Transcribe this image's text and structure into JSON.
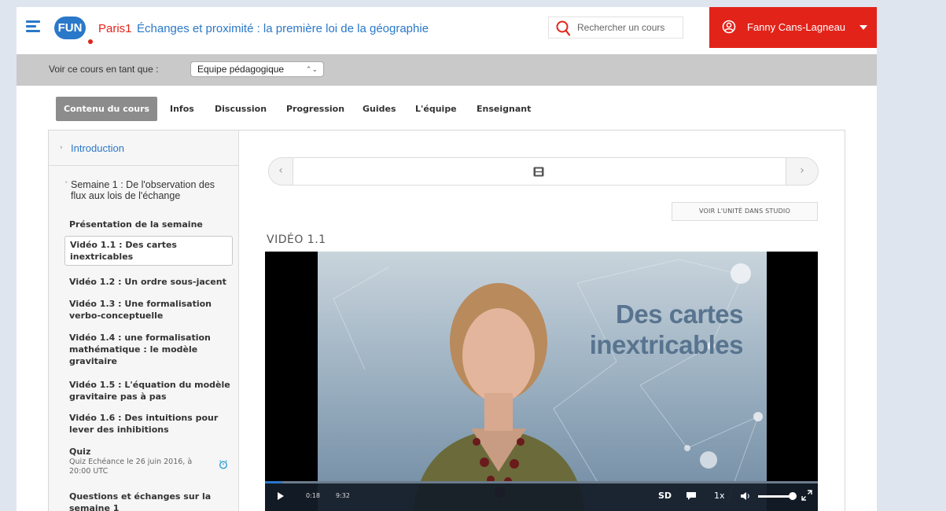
{
  "header": {
    "logo": "FUN",
    "course_org": "Paris1",
    "course_title": "Échanges et proximité : la première loi de la géographie",
    "search_placeholder": "Rechercher un cours",
    "user_name": "Fanny Cans-Lagneau"
  },
  "view_as": {
    "label": "Voir ce cours en tant que :",
    "selected": "Equipe pédagogique",
    "arrows": "⌃⌄"
  },
  "tabs": [
    "Contenu du cours",
    "Infos",
    "Discussion",
    "Progression",
    "Guides",
    "L'équipe",
    "Enseignant"
  ],
  "sidebar": {
    "intro": "Introduction",
    "week": "Semaine 1 : De l'observation des flux aux lois de l'échange",
    "items": [
      "Présentation de la semaine",
      "Vidéo 1.1 : Des cartes inextricables",
      "Vidéo 1.2 : Un ordre sous-jacent",
      "Vidéo 1.3 : Une formalisation verbo-conceptuelle",
      "Vidéo 1.4 : une formalisation mathématique : le modèle gravitaire",
      "Vidéo 1.5 : L'équation du modèle gravitaire pas à pas",
      "Vidéo 1.6 : Des intuitions pour lever des inhibitions",
      "Quiz",
      "Questions et échanges sur la semaine 1"
    ],
    "quiz_due": "Quiz Echéance le 26 juin 2016, à 20:00 UTC"
  },
  "main": {
    "studio_button": "VOIR L'UNITÉ DANS STUDIO",
    "video_heading": "VIDÉO 1.1",
    "video_overlay_line1": "Des cartes",
    "video_overlay_line2": "inextricables",
    "time_current": "0:18",
    "time_total": "9:32",
    "progress_fraction": 0.031,
    "quality": "SD",
    "speed": "1x",
    "volume_fraction": 0.87
  },
  "colors": {
    "brand_blue": "#2a78c9",
    "brand_red": "#e2231a",
    "active_tab": "#8c8c8c"
  },
  "icons": [
    "menu-icon",
    "search-icon",
    "user-icon",
    "film-icon",
    "alarm-clock-icon",
    "play-icon",
    "captions-icon",
    "volume-icon",
    "fullscreen-icon"
  ]
}
